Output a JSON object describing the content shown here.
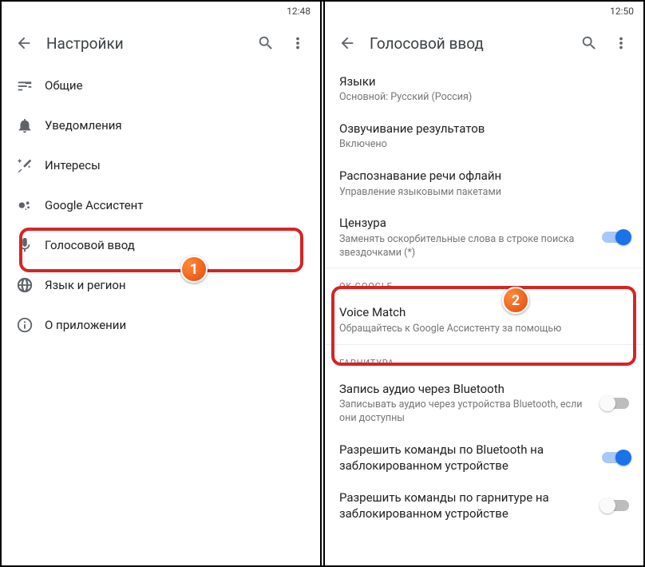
{
  "left": {
    "time": "12:48",
    "title": "Настройки",
    "items": [
      {
        "label": "Общие"
      },
      {
        "label": "Уведомления"
      },
      {
        "label": "Интересы"
      },
      {
        "label": "Google Ассистент"
      },
      {
        "label": "Голосовой ввод"
      },
      {
        "label": "Язык и регион"
      },
      {
        "label": "О приложении"
      }
    ]
  },
  "right": {
    "time": "12:50",
    "title": "Голосовой ввод",
    "rows": {
      "languages": {
        "title": "Языки",
        "sub": "Основной: Русский (Россия)"
      },
      "tts": {
        "title": "Озвучивание результатов",
        "sub": "Включено"
      },
      "offline": {
        "title": "Распознавание речи офлайн",
        "sub": "Управление языковыми пакетами"
      },
      "censor": {
        "title": "Цензура",
        "sub": "Заменять оскорбительные слова в строке поиска звездочками (*)"
      },
      "voicematch": {
        "title": "Voice Match",
        "sub": "Обращайтесь к Google Ассистенту за помощью"
      },
      "btrec": {
        "title": "Запись аудио через Bluetooth",
        "sub": "Записывать аудио через устройства Bluetooth, если они доступны"
      },
      "btlock": {
        "title": "Разрешить команды по Bluetooth на заблокированном устройстве",
        "sub": ""
      },
      "headset": {
        "title": "Разрешить команды по гарнитуре на заблокированном устройстве",
        "sub": ""
      }
    },
    "sections": {
      "okgoogle": "OK GOOGLE",
      "garnish": "ГАРНИТУРА"
    }
  },
  "badges": {
    "one": "1",
    "two": "2"
  }
}
